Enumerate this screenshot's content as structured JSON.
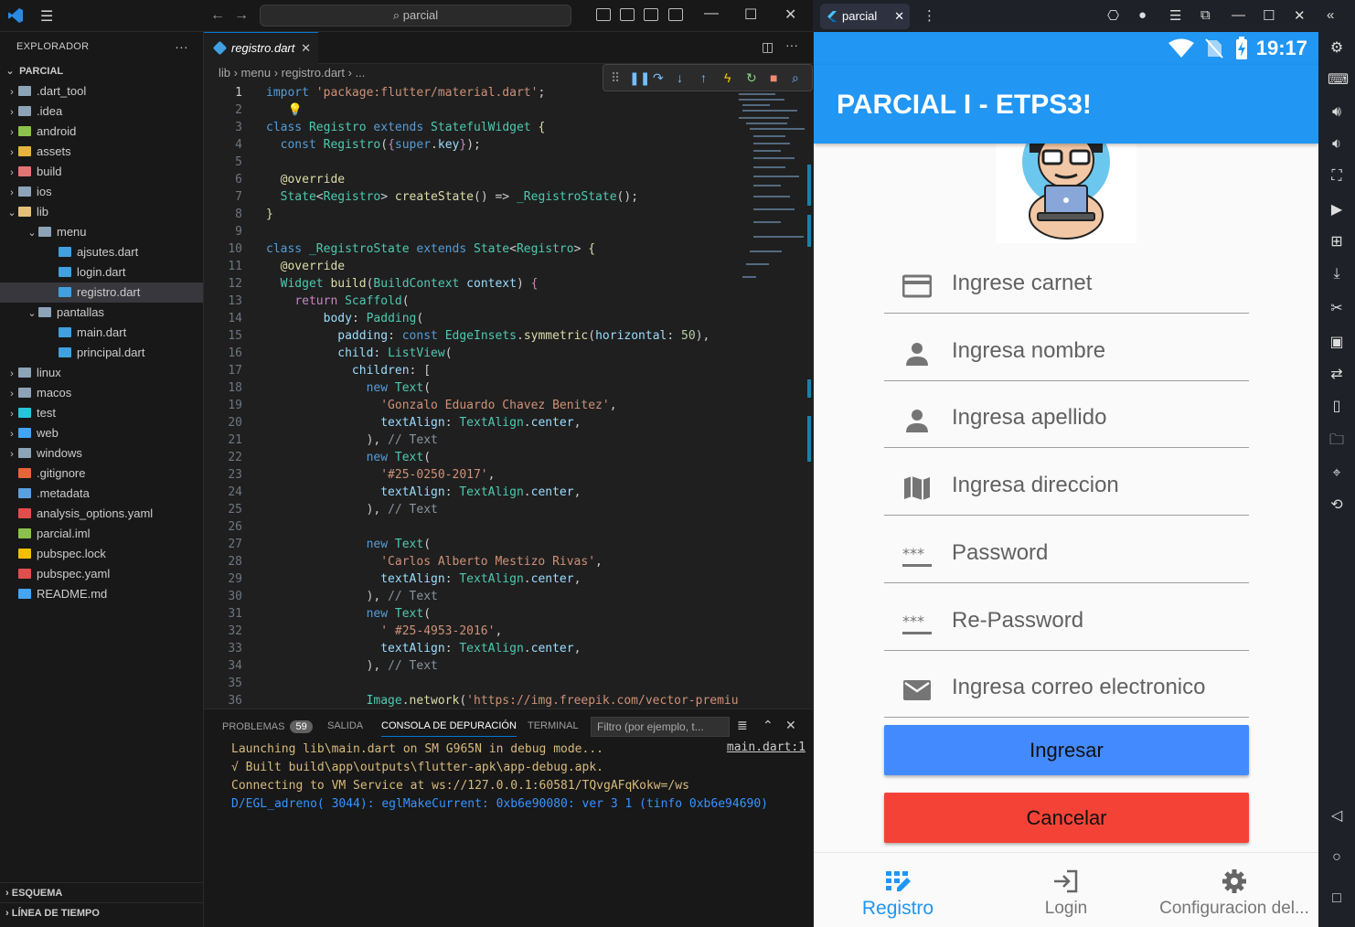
{
  "vscode": {
    "search_label": "⌕ parcial",
    "explorer_title": "EXPLORADOR",
    "explorer_more": "···",
    "project": "PARCIAL",
    "tree": [
      {
        "label": ".dart_tool",
        "chev": "›",
        "indent": 0,
        "color": "#8da4b8"
      },
      {
        "label": ".idea",
        "chev": "›",
        "indent": 0,
        "color": "#8da4b8"
      },
      {
        "label": "android",
        "chev": "›",
        "indent": 0,
        "color": "#8bc34a"
      },
      {
        "label": "assets",
        "chev": "›",
        "indent": 0,
        "color": "#e5b43c"
      },
      {
        "label": "build",
        "chev": "›",
        "indent": 0,
        "color": "#e57373"
      },
      {
        "label": "ios",
        "chev": "›",
        "indent": 0,
        "color": "#8da4b8"
      },
      {
        "label": "lib",
        "chev": "⌄",
        "indent": 0,
        "color": "#e5c07b"
      },
      {
        "label": "menu",
        "chev": "⌄",
        "indent": 1,
        "color": "#8da4b8"
      },
      {
        "label": "ajsutes.dart",
        "chev": "",
        "indent": 2,
        "color": "#40a0e0"
      },
      {
        "label": "login.dart",
        "chev": "",
        "indent": 2,
        "color": "#40a0e0"
      },
      {
        "label": "registro.dart",
        "chev": "",
        "indent": 2,
        "color": "#40a0e0",
        "selected": true
      },
      {
        "label": "pantallas",
        "chev": "⌄",
        "indent": 1,
        "color": "#8da4b8"
      },
      {
        "label": "main.dart",
        "chev": "",
        "indent": 2,
        "color": "#40a0e0"
      },
      {
        "label": "principal.dart",
        "chev": "",
        "indent": 2,
        "color": "#40a0e0"
      },
      {
        "label": "linux",
        "chev": "›",
        "indent": 0,
        "color": "#8da4b8"
      },
      {
        "label": "macos",
        "chev": "›",
        "indent": 0,
        "color": "#8da4b8"
      },
      {
        "label": "test",
        "chev": "›",
        "indent": 0,
        "color": "#26c6da"
      },
      {
        "label": "web",
        "chev": "›",
        "indent": 0,
        "color": "#42a5f5"
      },
      {
        "label": "windows",
        "chev": "›",
        "indent": 0,
        "color": "#8da4b8"
      },
      {
        "label": ".gitignore",
        "chev": "",
        "indent": 0,
        "color": "#e8643b"
      },
      {
        "label": ".metadata",
        "chev": "",
        "indent": 0,
        "color": "#5aa0e0"
      },
      {
        "label": "analysis_options.yaml",
        "chev": "",
        "indent": 0,
        "color": "#e54c4c"
      },
      {
        "label": "parcial.iml",
        "chev": "",
        "indent": 0,
        "color": "#8bc34a"
      },
      {
        "label": "pubspec.lock",
        "chev": "",
        "indent": 0,
        "color": "#f0c000"
      },
      {
        "label": "pubspec.yaml",
        "chev": "",
        "indent": 0,
        "color": "#e54c4c"
      },
      {
        "label": "README.md",
        "chev": "",
        "indent": 0,
        "color": "#42a5f5"
      }
    ],
    "outline": "ESQUEMA",
    "timeline": "LÍNEA DE TIEMPO",
    "tab_label": "registro.dart",
    "breadcrumb": "lib › menu › registro.dart › ...",
    "panel": {
      "tabs": [
        "PROBLEMAS",
        "SALIDA",
        "CONSOLA DE DEPURACIÓN",
        "TERMINAL"
      ],
      "problems_count": "59",
      "filter_placeholder": "Filtro (por ejemplo, t...",
      "link": "main.dart:1",
      "lines": [
        "Launching lib\\main.dart on SM G965N in debug mode...",
        "√  Built build\\app\\outputs\\flutter-apk\\app-debug.apk.",
        "Connecting to VM Service at ws://127.0.0.1:60581/TQvgAFqKokw=/ws",
        "D/EGL_adreno( 3044): eglMakeCurrent: 0xb6e90080: ver 3 1 (tinfo 0xb6e94690)"
      ]
    }
  },
  "emulator": {
    "tab_label": "parcial",
    "clock": "19:17",
    "app_title": "PARCIAL I - ETPS3!",
    "fields": [
      {
        "icon": "credit-card-icon",
        "label": "Ingrese carnet"
      },
      {
        "icon": "person-icon",
        "label": "Ingresa nombre"
      },
      {
        "icon": "person-icon",
        "label": "Ingresa apellido"
      },
      {
        "icon": "map-icon",
        "label": "Ingresa direccion"
      },
      {
        "icon": "password-icon",
        "label": "Password"
      },
      {
        "icon": "password-icon",
        "label": "Re-Password"
      },
      {
        "icon": "email-icon",
        "label": "Ingresa correo electronico"
      }
    ],
    "btn_ingresar": "Ingresar",
    "btn_cancelar": "Cancelar",
    "nav": [
      {
        "icon": "registro-icon",
        "label": "Registro",
        "active": true
      },
      {
        "icon": "login-icon",
        "label": "Login",
        "active": false
      },
      {
        "icon": "gear-icon",
        "label": "Configuracion del...",
        "active": false
      }
    ]
  }
}
